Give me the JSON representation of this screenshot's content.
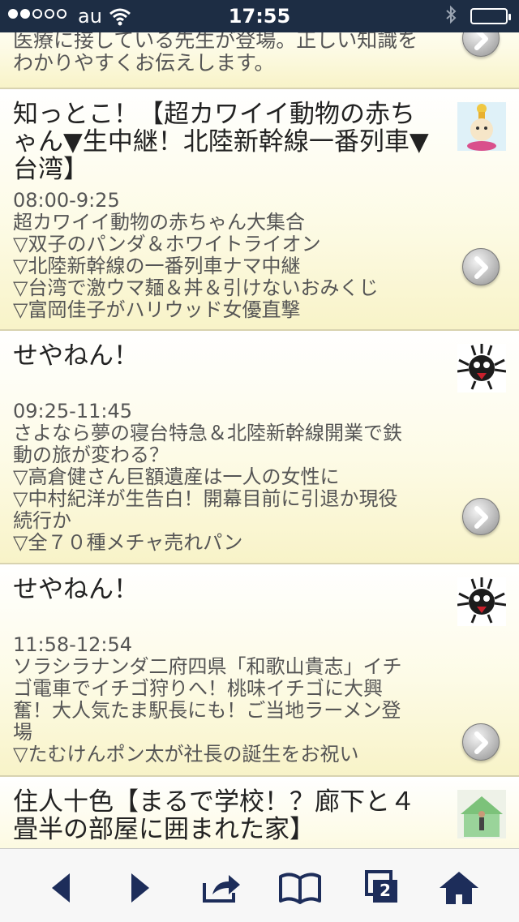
{
  "status_bar": {
    "carrier": "au",
    "time": "17:55"
  },
  "programs": [
    {
      "desc": "医療に接している先生が登場。正しい知識を\nわかりやすくお伝えします。"
    },
    {
      "title": "知っとこ！【超カワイイ動物の赤ちゃん▼生中継！北陸新幹線一番列車▼台湾】",
      "desc": "08:00-9:25\n超カワイイ動物の赤ちゃん大集合\n▽双子のパンダ＆ホワイトライオン\n▽北陸新幹線の一番列車ナマ中継\n▽台湾で激ウマ麺＆丼＆引けないおみくじ\n▽富岡佳子がハリウッド女優直撃"
    },
    {
      "title": "せやねん！",
      "desc": "09:25-11:45\nさよなら夢の寝台特急＆北陸新幹線開業で鉄\n動の旅が変わる？\n▽高倉健さん巨額遺産は一人の女性に\n▽中村紀洋が生告白！開幕目前に引退か現役\n続行か\n▽全７０種メチャ売れパン"
    },
    {
      "title": "せやねん！",
      "desc": "11:58-12:54\nソラシラナンダ二府四県「和歌山貴志」イチ\nゴ電車でイチゴ狩りへ！桃味イチゴに大興\n奮！大人気たま駅長にも！ご当地ラーメン登\n場\n▽たむけんポン太が社長の誕生をお祝い"
    },
    {
      "title": "住人十色【まるで学校！？廊下と４畳半の部屋に囲まれた家】"
    }
  ],
  "toolbar": {
    "tabs_count": "2"
  }
}
